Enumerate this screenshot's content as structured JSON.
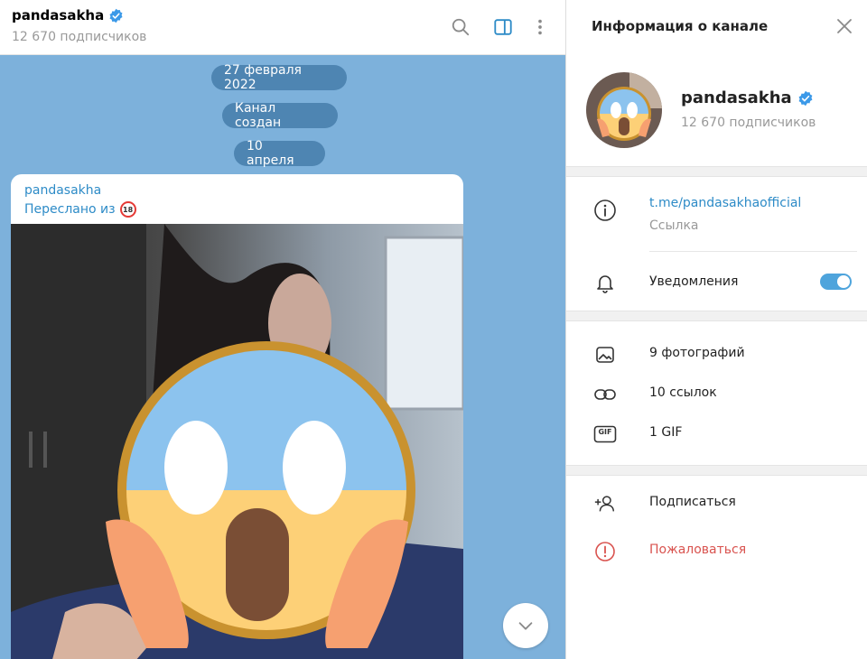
{
  "chat": {
    "channel_name": "pandasakha",
    "subscribers": "12 670 подписчиков",
    "icons": [
      "search-icon",
      "sidebar-toggle-icon",
      "more-vertical-icon"
    ],
    "date_pills": [
      "27 февраля 2022",
      "Канал создан",
      "10 апреля"
    ],
    "message": {
      "author": "pandasakha",
      "forwarded": "Переслано из",
      "badge": "18"
    }
  },
  "info": {
    "title": "Информация о канале",
    "channel_name": "pandasakha",
    "subscribers": "12 670 подписчиков",
    "link": "t.me/pandasakhaofficial",
    "link_label": "Ссылка",
    "notifications": "Уведомления",
    "notifications_on": true,
    "media": {
      "photos": "9 фотографий",
      "links": "10 ссылок",
      "gif": "1 GIF",
      "gif_icon_text": "GIF"
    },
    "subscribe": "Подписаться",
    "report": "Пожаловаться"
  },
  "colors": {
    "accent": "#2d8bc7",
    "chat_background": "#7db1db",
    "pill": "#4e85b2",
    "danger": "#d9534f",
    "toggle": "#4ea4dc"
  }
}
